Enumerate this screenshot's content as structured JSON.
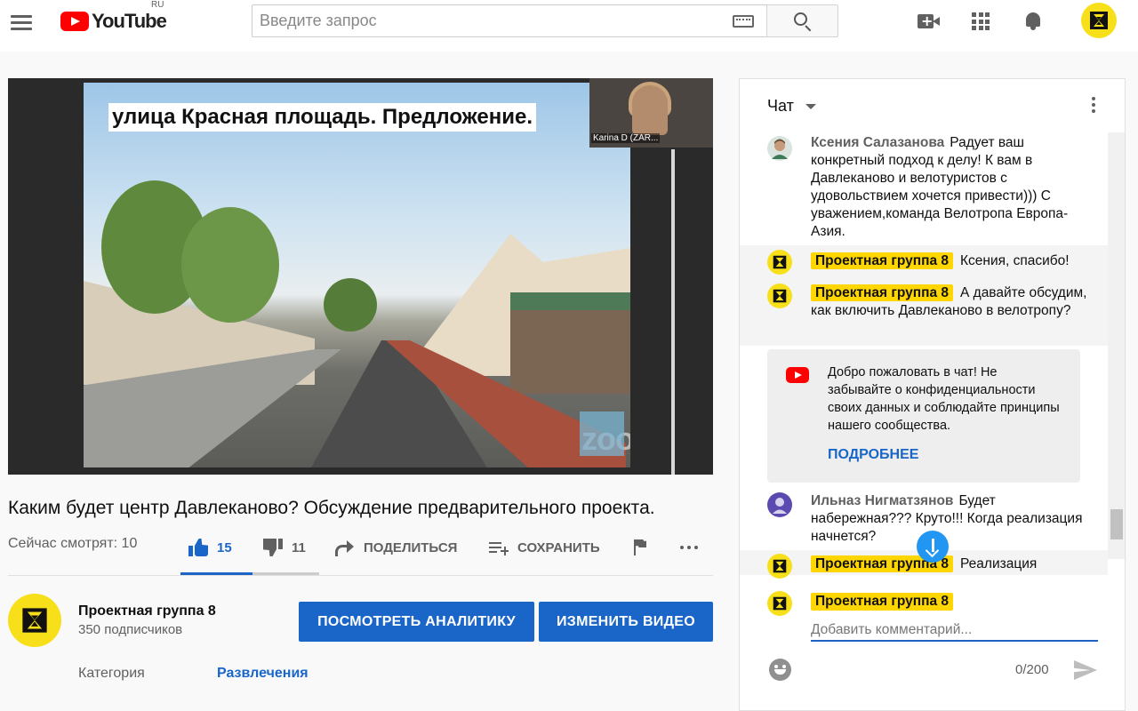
{
  "header": {
    "logo_text": "YouTube",
    "logo_region": "RU",
    "search_placeholder": "Введите запрос",
    "icons": [
      "menu-icon",
      "keyboard-icon",
      "search-icon",
      "create-video-icon",
      "apps-icon",
      "notifications-icon"
    ]
  },
  "video": {
    "slide_title": "улица Красная площадь. Предложение.",
    "participant_label": "Karina D (ZAR...",
    "watermark": "zoom"
  },
  "info": {
    "title": "Каким будет центр Давлеканово? Обсуждение предварительного проекта.",
    "watching": "Сейчас смотрят: 10",
    "likes": "15",
    "dislikes": "11",
    "share_label": "ПОДЕЛИТЬСЯ",
    "save_label": "СОХРАНИТЬ"
  },
  "channel": {
    "name": "Проектная группа 8",
    "subscribers": "350 подписчиков",
    "analytics_button": "ПОСМОТРЕТЬ АНАЛИТИКУ",
    "edit_button": "ИЗМЕНИТЬ ВИДЕО",
    "category_label": "Категория",
    "category_value": "Развлечения"
  },
  "chat": {
    "title": "Чат",
    "messages": [
      {
        "author": "Ксения Салазанова",
        "text": "Радует ваш конкретный подход к делу! К вам в Давлеканово и велотуристов с удовольствием хочется привести))) С уважением,команда Велотропа Европа-Азия.",
        "owner": false
      },
      {
        "author": "Проектная группа 8",
        "text": "Ксения, спасибо!",
        "owner": true
      },
      {
        "author": "Проектная группа 8",
        "text": "А давайте обсудим, как включить Давлеканово в велотропу?",
        "owner": true
      },
      {
        "author": "Ильназ Нигматзянов",
        "text": "Будет набережная??? Круто!!! Когда реализация начнется?",
        "owner": false
      },
      {
        "author": "Проектная группа 8",
        "text": "Реализация",
        "owner": true
      }
    ],
    "welcome_text": "Добро пожаловать в чат! Не забывайте о конфиденциальности своих данных и соблюдайте принципы нашего сообщества.",
    "welcome_link": "ПОДРОБНЕЕ",
    "input_author": "Проектная группа 8",
    "input_placeholder": "Добавить комментарий...",
    "char_counter": "0/200"
  },
  "colors": {
    "accent_blue": "#1a66c8",
    "youtube_red": "#ff0000",
    "owner_badge": "#ffd600",
    "channel_yellow": "#f7e01a"
  }
}
